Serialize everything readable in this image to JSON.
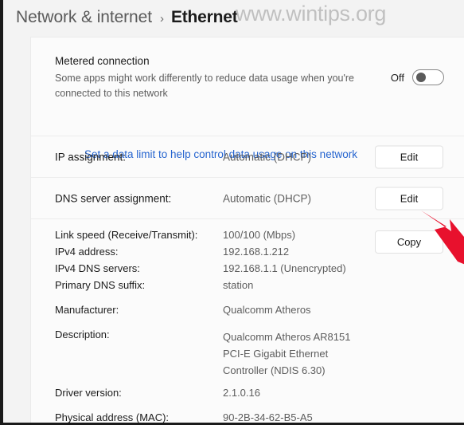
{
  "header": {
    "breadcrumb_parent": "Network & internet",
    "breadcrumb_separator": "›",
    "breadcrumb_current": "Ethernet",
    "watermark": "www.wintips.org"
  },
  "metered": {
    "title": "Metered connection",
    "description": "Some apps might work differently to reduce data usage when you're connected to this network",
    "toggle_state_label": "Off",
    "data_limit_link": "Set a data limit to help control data usage on this network"
  },
  "assignments": [
    {
      "label": "IP assignment:",
      "value": "Automatic (DHCP)",
      "button": "Edit"
    },
    {
      "label": "DNS server assignment:",
      "value": "Automatic (DHCP)",
      "button": "Edit"
    }
  ],
  "details": {
    "copy_button": "Copy",
    "rows": [
      {
        "label": "Link speed (Receive/Transmit):",
        "value": "100/100 (Mbps)"
      },
      {
        "label": "IPv4 address:",
        "value": "192.168.1.212"
      },
      {
        "label": "IPv4 DNS servers:",
        "value": "192.168.1.1 (Unencrypted)"
      },
      {
        "label": "Primary DNS suffix:",
        "value": "station"
      },
      {
        "label": "Manufacturer:",
        "value": "Qualcomm Atheros"
      },
      {
        "label": "Description:",
        "value_line1": "Qualcomm Atheros AR8151",
        "value_line2": "PCI-E Gigabit Ethernet",
        "value_line3": "Controller (NDIS 6.30)"
      },
      {
        "label": "Driver version:",
        "value": "2.1.0.16"
      },
      {
        "label": "Physical address (MAC):",
        "value": "90-2B-34-62-B5-A5"
      }
    ]
  },
  "colors": {
    "accent_link": "#2564cf",
    "annotation_arrow": "#e8112d",
    "page_background": "#f3f3f3",
    "card_background": "#fbfbfb"
  }
}
